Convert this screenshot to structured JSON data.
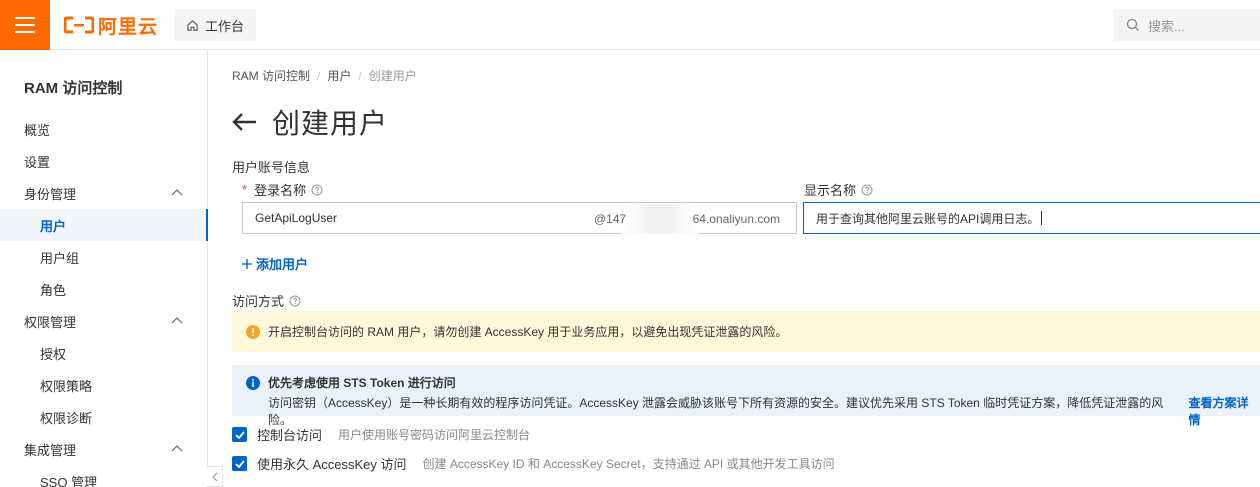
{
  "header": {
    "logo_text": "阿里云",
    "workbench_label": "工作台",
    "search_placeholder": "搜索..."
  },
  "sidebar": {
    "title": "RAM 访问控制",
    "items": [
      {
        "label": "概览"
      },
      {
        "label": "设置"
      },
      {
        "label": "身份管理"
      },
      {
        "label": "用户"
      },
      {
        "label": "用户组"
      },
      {
        "label": "角色"
      },
      {
        "label": "权限管理"
      },
      {
        "label": "授权"
      },
      {
        "label": "权限策略"
      },
      {
        "label": "权限诊断"
      },
      {
        "label": "集成管理"
      },
      {
        "label": "SSO 管理"
      }
    ]
  },
  "breadcrumb": [
    "RAM 访问控制",
    "用户",
    "创建用户"
  ],
  "page": {
    "title": "创建用户",
    "account_section": "用户账号信息",
    "login_name_label": "登录名称",
    "login_name_value": "GetApiLogUser",
    "login_domain_prefix": "@147",
    "login_domain_suffix": "64.onaliyun.com",
    "display_name_label": "显示名称",
    "display_name_value": "用于查询其他阿里云账号的API调用日志。",
    "add_user_label": "添加用户",
    "access_section": "访问方式",
    "warning_text": "开启控制台访问的 RAM 用户，请勿创建 AccessKey 用于业务应用，以避免出现凭证泄露的风险。",
    "info_title": "优先考虑使用 STS Token 进行访问",
    "info_body": "访问密钥（AccessKey）是一种长期有效的程序访问凭证。AccessKey 泄露会威胁该账号下所有资源的安全。建议优先采用 STS Token 临时凭证方案，降低凭证泄露的风险。",
    "info_link": "查看方案详情",
    "options": [
      {
        "label": "控制台访问",
        "desc": "用户使用账号密码访问阿里云控制台",
        "checked": true
      },
      {
        "label": "使用永久 AccessKey 访问",
        "desc": "创建 AccessKey ID 和 AccessKey Secret，支持通过 API 或其他开发工具访问",
        "checked": true
      }
    ]
  },
  "colors": {
    "brand": "#ff6a00",
    "primary": "#0064c8",
    "warning_bg": "#fff7d9",
    "info_bg": "#eaf1f8"
  }
}
